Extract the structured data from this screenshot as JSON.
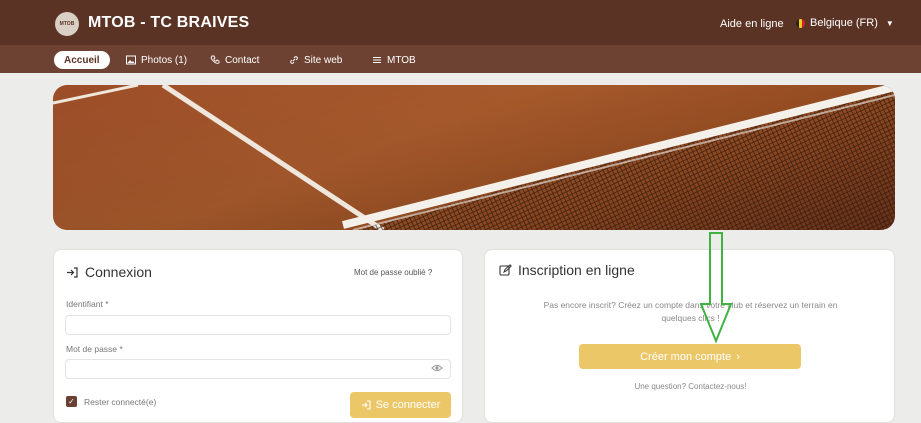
{
  "header": {
    "logo_text": "MTOB",
    "title": "MTOB - TC BRAIVES",
    "help": "Aide en ligne",
    "language": "Belgique (FR)"
  },
  "nav": {
    "items": [
      {
        "label": "Accueil",
        "icon": "none"
      },
      {
        "label": "Photos (1)",
        "icon": "image-icon"
      },
      {
        "label": "Contact",
        "icon": "phone-icon"
      },
      {
        "label": "Site web",
        "icon": "link-icon"
      },
      {
        "label": "MTOB",
        "icon": "menu-icon"
      }
    ]
  },
  "login": {
    "title": "Connexion",
    "forgot": "Mot de passe oublié ?",
    "id_label": "Identifiant *",
    "id_value": "",
    "pw_label": "Mot de passe *",
    "pw_value": "",
    "remember": "Rester connecté(e)",
    "submit": "Se connecter"
  },
  "register": {
    "title": "Inscription en ligne",
    "text1": "Pas encore inscrit? Créez un compte dans votre club et réservez un terrain en",
    "text2": "quelques clics !",
    "button": "Créer mon compte",
    "question": "Une question? Contactez-nous!"
  },
  "colors": {
    "header": "#5a3325",
    "nav": "#6e4233",
    "accent": "#ecc768",
    "arrow": "#3fb33f"
  }
}
